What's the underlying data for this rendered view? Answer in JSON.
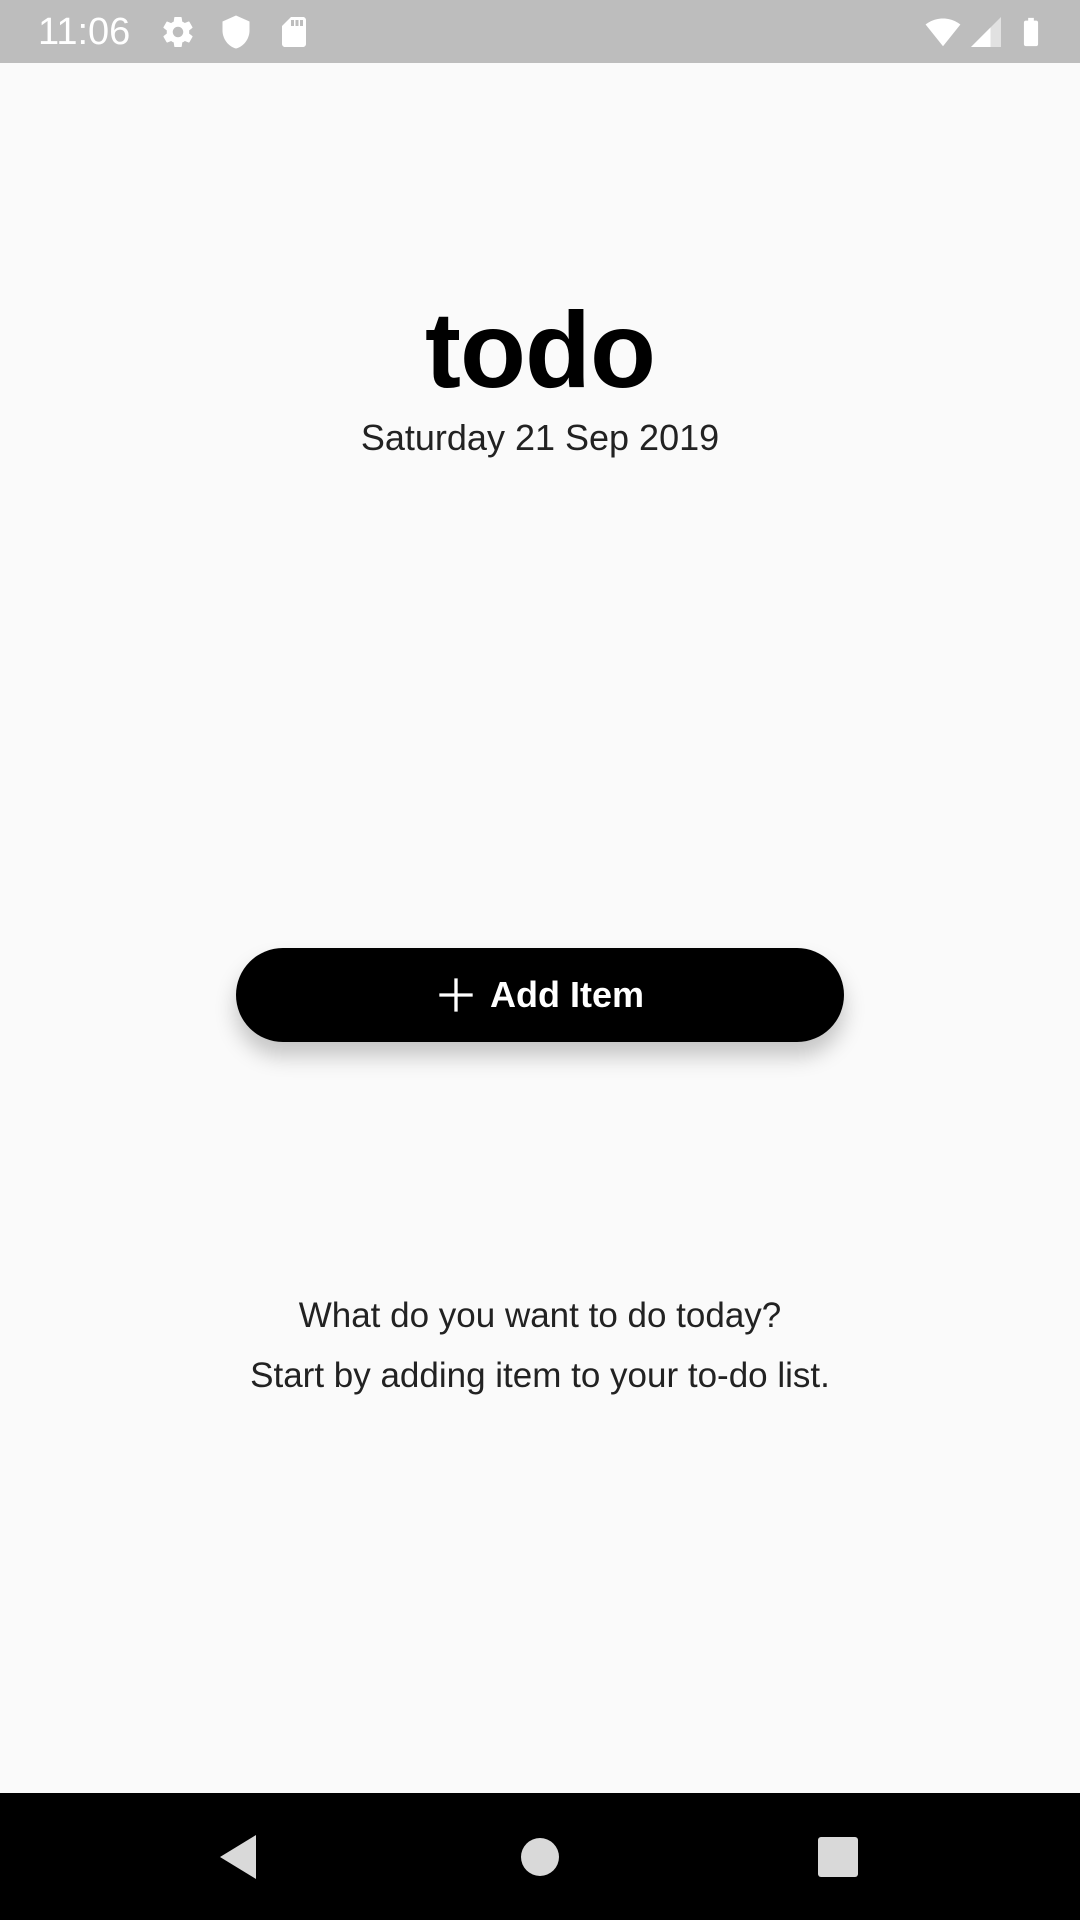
{
  "status_bar": {
    "time": "11:06",
    "left_icons": [
      "gear-icon",
      "shield-icon",
      "sd-card-icon"
    ],
    "right_icons": [
      "wifi-icon",
      "cell-signal-icon",
      "battery-icon"
    ]
  },
  "header": {
    "title": "todo",
    "date": "Saturday 21 Sep 2019"
  },
  "add_button": {
    "icon": "plus-icon",
    "label": "Add Item"
  },
  "empty_state": {
    "line1": "What do you want to do today?",
    "line2": "Start by adding item to your to-do list."
  },
  "nav_bar": {
    "buttons": [
      "back-icon",
      "home-icon",
      "recents-icon"
    ]
  },
  "colors": {
    "background": "#fafafa",
    "status_bar": "#bdbdbd",
    "button": "#000000",
    "button_text": "#ffffff",
    "nav_bar": "#000000"
  }
}
